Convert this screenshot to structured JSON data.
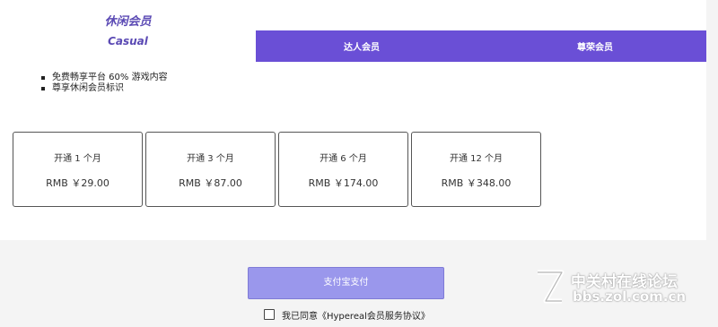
{
  "tabs": {
    "casual_cn": "休闲会员",
    "casual_en": "Casual",
    "daren": "达人会员",
    "zunrong": "尊荣会员"
  },
  "features": [
    "免费畅享平台 60% 游戏内容",
    "尊享休闲会员标识"
  ],
  "plans": [
    {
      "duration": "开通 1 个月",
      "price": "RMB ￥29.00"
    },
    {
      "duration": "开通 3 个月",
      "price": "RMB ￥87.00"
    },
    {
      "duration": "开通 6 个月",
      "price": "RMB ￥174.00"
    },
    {
      "duration": "开通 12 个月",
      "price": "RMB ￥348.00"
    }
  ],
  "pay_button": "支付宝支付",
  "agreement": "我已同意《Hypereal会员服务协议》",
  "watermark": {
    "title": "中关村在线论坛",
    "url": "bbs.zol.com.cn"
  },
  "colors": {
    "tab_bar": "#6a4fd6",
    "tab_active_text": "#5b4ab4",
    "pay_button": "#9a97ec"
  }
}
